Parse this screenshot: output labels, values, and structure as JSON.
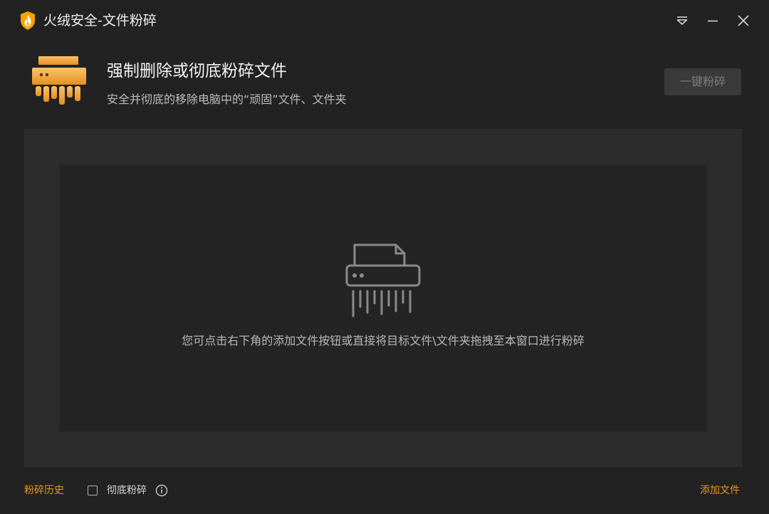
{
  "window": {
    "title": "火绒安全-文件粉碎",
    "logo_icon": "huorong-flame-shield-icon",
    "controls": [
      "menu-icon",
      "minimize-icon",
      "close-icon"
    ]
  },
  "header": {
    "icon": "paper-shredder-icon",
    "title": "强制删除或彻底粉碎文件",
    "subtitle": "安全并彻底的移除电脑中的“顽固”文件、文件夹",
    "action_label": "一键粉碎"
  },
  "drop_zone": {
    "icon": "shredder-outline-icon",
    "hint": "您可点击右下角的添加文件按钮或直接将目标文件\\文件夹拖拽至本窗口进行粉碎"
  },
  "footer": {
    "history_label": "粉碎历史",
    "thorough_label": "彻底粉碎",
    "thorough_checked": false,
    "add_file_label": "添加文件"
  },
  "colors": {
    "background": "#222222",
    "panel": "#2c2c2c",
    "inner_panel": "#242424",
    "accent": "#e8961e",
    "disabled_button": "#3a3a3a",
    "disabled_text": "#7c7c7c"
  }
}
